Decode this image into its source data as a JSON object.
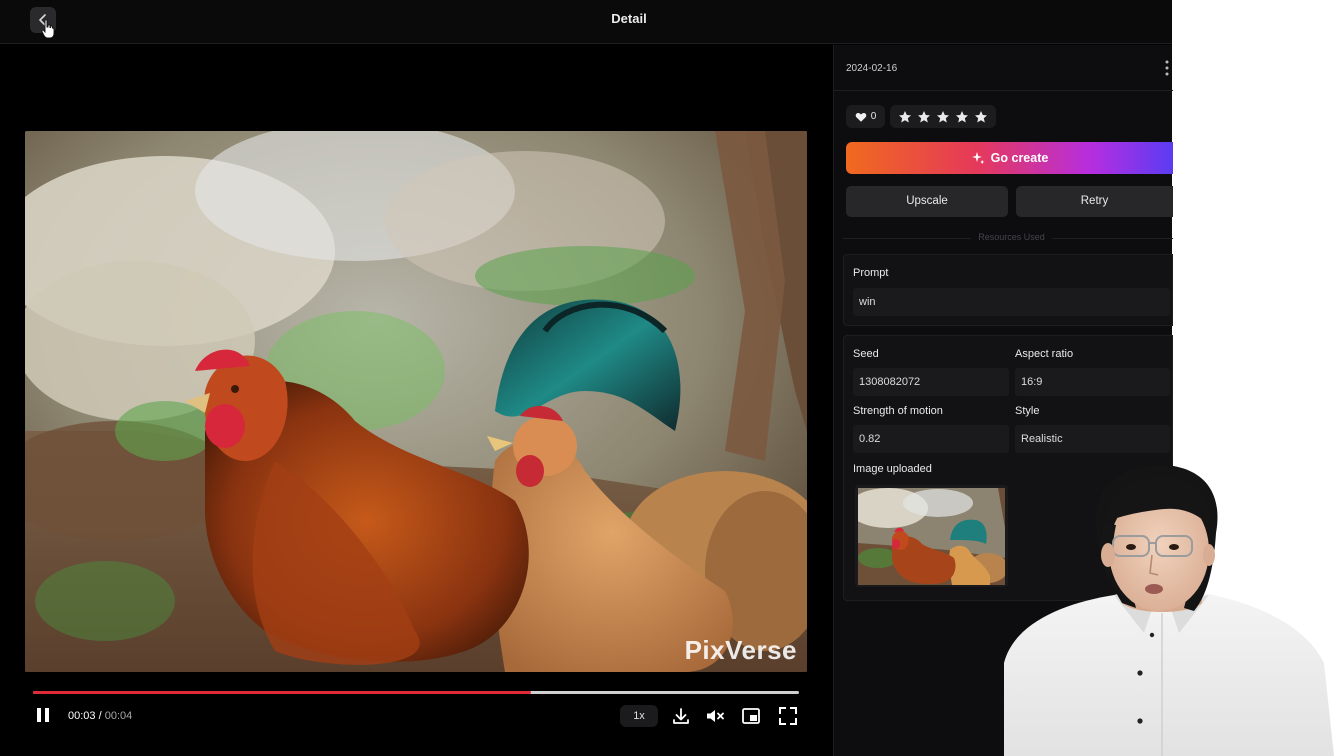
{
  "header": {
    "title": "Detail",
    "back_icon": "chevron-left-icon"
  },
  "player": {
    "watermark": "PixVerse",
    "current_time": "00:03",
    "separator": "/",
    "duration": "00:04",
    "progress_fraction": 0.65,
    "speed_label": "1x",
    "progress_color": "#e02a3a"
  },
  "panel": {
    "date": "2024-02-16",
    "like_count": "0",
    "rating_stars": 5,
    "go_create_label": "Go create",
    "upscale_label": "Upscale",
    "retry_label": "Retry",
    "resources_label": "Resources Used",
    "prompt_label": "Prompt",
    "prompt_value": "win",
    "seed_label": "Seed",
    "seed_value": "1308082072",
    "aspect_label": "Aspect ratio",
    "aspect_value": "16:9",
    "motion_label": "Strength of motion",
    "motion_value": "0.82",
    "style_label": "Style",
    "style_value": "Realistic",
    "image_label": "Image uploaded"
  },
  "colors": {
    "gradient_start": "#f06a1e",
    "gradient_mid": "#b62ee0",
    "gradient_end": "#5b3cf2",
    "background": "#000000"
  }
}
